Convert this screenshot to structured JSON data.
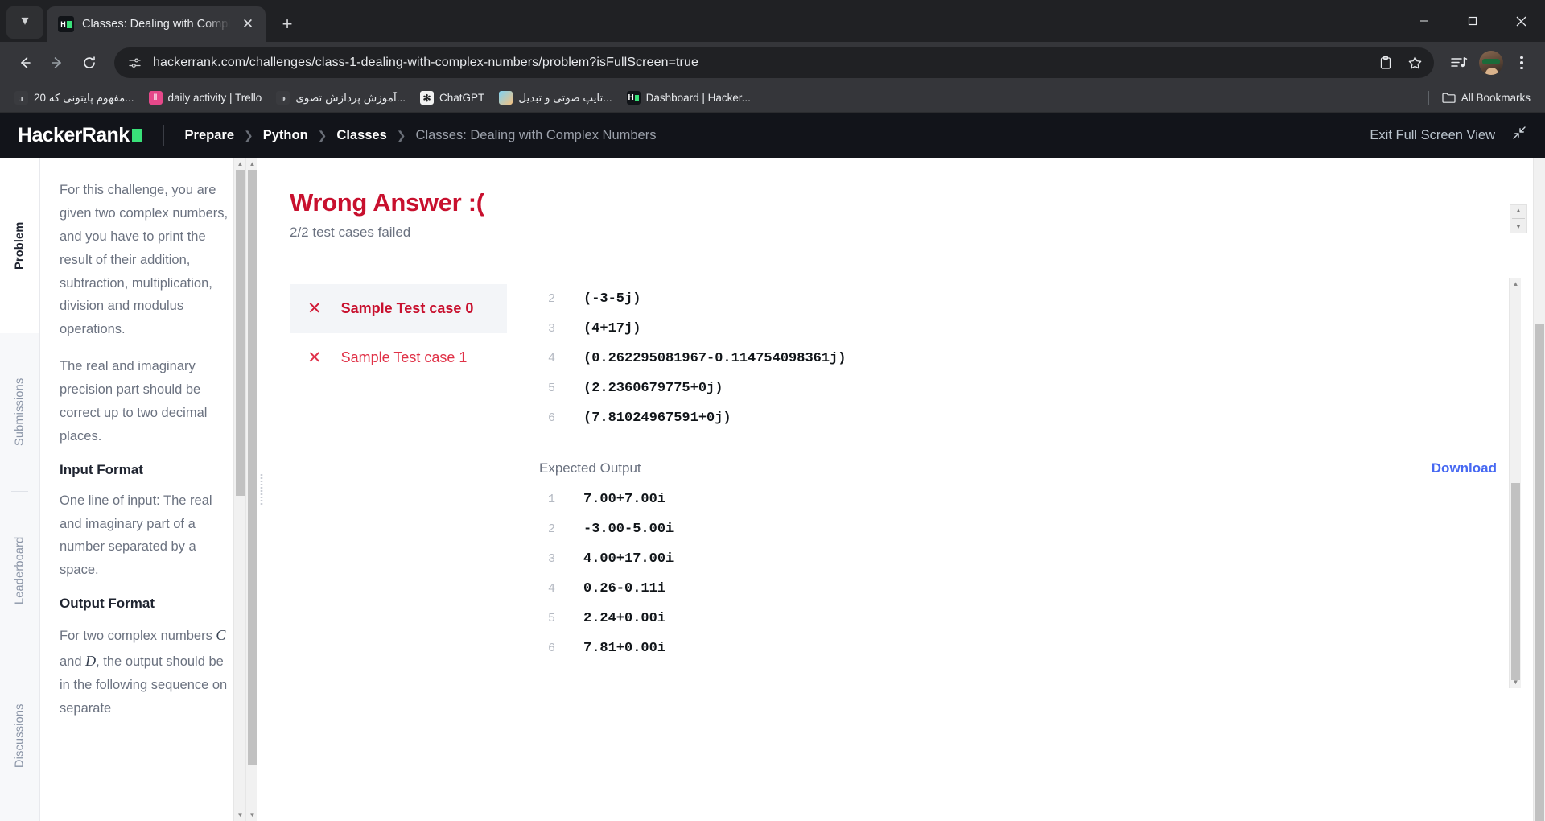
{
  "browser": {
    "tab": {
      "title": "Classes: Dealing with Complex N",
      "favicon_name": "hackerrank-favicon",
      "close_label": "✕"
    },
    "tab_list_chevron": "⌄",
    "new_tab_label": "+",
    "window_controls": {
      "minimize": "—",
      "maximize": "❐",
      "close": "✕"
    },
    "nav": {
      "back": "←",
      "forward": "→",
      "reload": "⟳"
    },
    "omnibox": {
      "url": "hackerrank.com/challenges/class-1-dealing-with-complex-numbers/problem?isFullScreen=true",
      "site_info_icon": "site-settings-icon",
      "clipboard_icon": "ὌB",
      "bookmark_star": "☆"
    },
    "toolbar_right": {
      "media_icon": "media-control-icon",
      "profile_icon": "profile-avatar",
      "menu_icon": "kebab-menu"
    },
    "bookmarks": [
      {
        "label": "20 مفهوم پایتونی که...",
        "icon": "globe-icon",
        "icon_class": "ico-globe",
        "glyph": "◑"
      },
      {
        "label": "daily activity | Trello",
        "icon": "trello-icon",
        "icon_class": "ico-trello",
        "glyph": "‖"
      },
      {
        "label": "آموزش پردازش تصوی...",
        "icon": "globe-icon",
        "icon_class": "ico-globe",
        "glyph": "◑"
      },
      {
        "label": "ChatGPT",
        "icon": "chatgpt-icon",
        "icon_class": "ico-chatgpt",
        "glyph": "✻"
      },
      {
        "label": "تایپ صوتی و تبدیل...",
        "icon": "app-icon",
        "icon_class": "ico-colorful",
        "glyph": ""
      },
      {
        "label": "Dashboard | Hacker...",
        "icon": "hackerrank-icon",
        "icon_class": "ico-hr",
        "glyph": "H"
      }
    ],
    "all_bookmarks": {
      "label": "All Bookmarks",
      "icon": "folder-icon",
      "glyph": "὜0"
    }
  },
  "hackerrank": {
    "logo": "HackerRank",
    "breadcrumbs": [
      {
        "label": "Prepare",
        "muted": false
      },
      {
        "label": "Python",
        "muted": false
      },
      {
        "label": "Classes",
        "muted": false
      },
      {
        "label": "Classes: Dealing with Complex Numbers",
        "muted": true
      }
    ],
    "breadcrumb_separator": "❯",
    "exit_fullscreen": {
      "label": "Exit Full Screen View",
      "icon": "collapse-arrows-icon",
      "glyph": "⤢"
    }
  },
  "side_tabs": [
    {
      "label": "Problem",
      "active": true
    },
    {
      "label": "Submissions",
      "active": false
    },
    {
      "label": "Leaderboard",
      "active": false
    },
    {
      "label": "Discussions",
      "active": false
    }
  ],
  "problem": {
    "paragraph_1": "For this challenge, you are given two complex numbers, and you have to print the result of their addition, subtraction, multiplication, division and modulus operations.",
    "paragraph_2": "The real and imaginary precision part should be correct up to two decimal places.",
    "input_format_heading": "Input Format",
    "input_format_text": "One line of input: The real and imaginary part of a number separated by a space.",
    "output_format_heading": "Output Format",
    "output_format_text_a": "For two complex numbers ",
    "output_format_var_c": "C",
    "output_format_text_b": " and ",
    "output_format_var_d": "D",
    "output_format_text_c": ", the output should be in the following sequence on separate"
  },
  "result": {
    "title": "Wrong Answer :(",
    "subtitle": "2/2 test cases failed",
    "title_color": "#c8102e"
  },
  "stepper": {
    "up": "▲",
    "down": "▼"
  },
  "test_cases": [
    {
      "label": "Sample Test case 0",
      "status_icon": "✕",
      "active": true
    },
    {
      "label": "Sample Test case 1",
      "status_icon": "✕",
      "active": false
    }
  ],
  "your_output": {
    "lines": [
      {
        "n": "2",
        "text": "(-3-5j)"
      },
      {
        "n": "3",
        "text": "(4+17j)"
      },
      {
        "n": "4",
        "text": "(0.262295081967-0.114754098361j)"
      },
      {
        "n": "5",
        "text": "(2.2360679775+0j)"
      },
      {
        "n": "6",
        "text": "(7.81024967591+0j)"
      }
    ]
  },
  "expected_output": {
    "label": "Expected Output",
    "download_label": "Download",
    "download_color": "#4668f2",
    "lines": [
      {
        "n": "1",
        "text": "7.00+7.00i"
      },
      {
        "n": "2",
        "text": "-3.00-5.00i"
      },
      {
        "n": "3",
        "text": "4.00+17.00i"
      },
      {
        "n": "4",
        "text": "0.26-0.11i"
      },
      {
        "n": "5",
        "text": "2.24+0.00i"
      },
      {
        "n": "6",
        "text": "7.81+0.00i"
      }
    ]
  },
  "scrollbars": {
    "up_arrow": "▲",
    "down_arrow": "▼"
  }
}
